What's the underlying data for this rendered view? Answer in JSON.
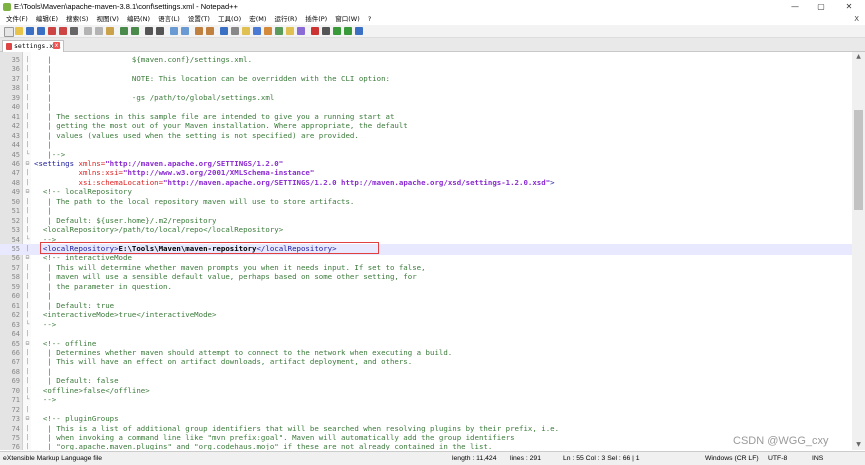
{
  "window": {
    "title": "E:\\Tools\\Maven\\apache-maven-3.8.1\\conf\\settings.xml - Notepad++",
    "minimize": "—",
    "maximize": "▢",
    "close": "✕"
  },
  "menu": [
    "文件(F)",
    "编辑(E)",
    "搜索(S)",
    "视图(V)",
    "编码(N)",
    "语言(L)",
    "设置(T)",
    "工具(O)",
    "宏(M)",
    "运行(R)",
    "插件(P)",
    "窗口(W)",
    "?"
  ],
  "menu_close": "X",
  "tab": {
    "label": "settings.xml",
    "close": "x"
  },
  "editor": {
    "lines": [
      {
        "n": "35",
        "f": "|",
        "segs": [
          {
            "c": "cm",
            "t": "   |                  ${maven.conf}/settings.xml."
          }
        ]
      },
      {
        "n": "36",
        "f": "|",
        "segs": [
          {
            "c": "cm",
            "t": "   |"
          }
        ]
      },
      {
        "n": "37",
        "f": "|",
        "segs": [
          {
            "c": "cm",
            "t": "   |                  NOTE: This location can be overridden with the CLI option:"
          }
        ]
      },
      {
        "n": "38",
        "f": "|",
        "segs": [
          {
            "c": "cm",
            "t": "   |"
          }
        ]
      },
      {
        "n": "39",
        "f": "|",
        "segs": [
          {
            "c": "cm",
            "t": "   |                  -gs /path/to/global/settings.xml"
          }
        ]
      },
      {
        "n": "40",
        "f": "|",
        "segs": [
          {
            "c": "cm",
            "t": "   |"
          }
        ]
      },
      {
        "n": "41",
        "f": "|",
        "segs": [
          {
            "c": "cm",
            "t": "   | The sections in this sample file are intended to give you a running start at"
          }
        ]
      },
      {
        "n": "42",
        "f": "|",
        "segs": [
          {
            "c": "cm",
            "t": "   | getting the most out of your Maven installation. Where appropriate, the default"
          }
        ]
      },
      {
        "n": "43",
        "f": "|",
        "segs": [
          {
            "c": "cm",
            "t": "   | values (values used when the setting is not specified) are provided."
          }
        ]
      },
      {
        "n": "44",
        "f": "|",
        "segs": [
          {
            "c": "cm",
            "t": "   |"
          }
        ]
      },
      {
        "n": "45",
        "f": "└",
        "segs": [
          {
            "c": "cm",
            "t": "   |-->"
          }
        ]
      },
      {
        "n": "46",
        "f": "⊟",
        "segs": [
          {
            "c": "tg",
            "t": "<settings "
          },
          {
            "c": "at",
            "t": "xmlns="
          },
          {
            "c": "av",
            "t": "\"http://maven.apache.org/SETTINGS/1.2.0\""
          }
        ]
      },
      {
        "n": "47",
        "f": "|",
        "segs": [
          {
            "c": "at",
            "t": "          xmlns:xsi="
          },
          {
            "c": "av",
            "t": "\"http://www.w3.org/2001/XMLSchema-instance\""
          }
        ]
      },
      {
        "n": "48",
        "f": "|",
        "segs": [
          {
            "c": "at",
            "t": "          xsi:schemaLocation="
          },
          {
            "c": "av",
            "t": "\"http://maven.apache.org/SETTINGS/1.2.0 http://maven.apache.org/xsd/settings-1.2.0.xsd\""
          },
          {
            "c": "tg",
            "t": ">"
          }
        ]
      },
      {
        "n": "49",
        "f": "⊟",
        "segs": [
          {
            "c": "cm",
            "t": "  <!-- localRepository"
          }
        ]
      },
      {
        "n": "50",
        "f": "|",
        "segs": [
          {
            "c": "cm",
            "t": "   | The path to the local repository maven will use to store artifacts."
          }
        ]
      },
      {
        "n": "51",
        "f": "|",
        "segs": [
          {
            "c": "cm",
            "t": "   |"
          }
        ]
      },
      {
        "n": "52",
        "f": "|",
        "segs": [
          {
            "c": "cm",
            "t": "   | Default: ${user.home}/.m2/repository"
          }
        ]
      },
      {
        "n": "53",
        "f": "|",
        "segs": [
          {
            "c": "cm",
            "t": "  <localRepository>/path/to/local/repo</localRepository>"
          }
        ]
      },
      {
        "n": "54",
        "f": "└",
        "segs": [
          {
            "c": "cm",
            "t": "  -->"
          }
        ]
      },
      {
        "n": "55",
        "f": "|",
        "cur": true,
        "segs": [
          {
            "c": "tg",
            "t": "  <localRepository>"
          },
          {
            "c": "tx",
            "t": "E:\\Tools\\Maven\\maven-repository"
          },
          {
            "c": "tg",
            "t": "</localRepository>"
          }
        ]
      },
      {
        "n": "56",
        "f": "⊟",
        "segs": [
          {
            "c": "cm",
            "t": "  <!-- interactiveMode"
          }
        ]
      },
      {
        "n": "57",
        "f": "|",
        "segs": [
          {
            "c": "cm",
            "t": "   | This will determine whether maven prompts you when it needs input. If set to false,"
          }
        ]
      },
      {
        "n": "58",
        "f": "|",
        "segs": [
          {
            "c": "cm",
            "t": "   | maven will use a sensible default value, perhaps based on some other setting, for"
          }
        ]
      },
      {
        "n": "59",
        "f": "|",
        "segs": [
          {
            "c": "cm",
            "t": "   | the parameter in question."
          }
        ]
      },
      {
        "n": "60",
        "f": "|",
        "segs": [
          {
            "c": "cm",
            "t": "   |"
          }
        ]
      },
      {
        "n": "61",
        "f": "|",
        "segs": [
          {
            "c": "cm",
            "t": "   | Default: true"
          }
        ]
      },
      {
        "n": "62",
        "f": "|",
        "segs": [
          {
            "c": "cm",
            "t": "  <interactiveMode>true</interactiveMode>"
          }
        ]
      },
      {
        "n": "63",
        "f": "└",
        "segs": [
          {
            "c": "cm",
            "t": "  -->"
          }
        ]
      },
      {
        "n": "64",
        "f": "|",
        "segs": [
          {
            "c": "cm",
            "t": ""
          }
        ]
      },
      {
        "n": "65",
        "f": "⊟",
        "segs": [
          {
            "c": "cm",
            "t": "  <!-- offline"
          }
        ]
      },
      {
        "n": "66",
        "f": "|",
        "segs": [
          {
            "c": "cm",
            "t": "   | Determines whether maven should attempt to connect to the network when executing a build."
          }
        ]
      },
      {
        "n": "67",
        "f": "|",
        "segs": [
          {
            "c": "cm",
            "t": "   | This will have an effect on artifact downloads, artifact deployment, and others."
          }
        ]
      },
      {
        "n": "68",
        "f": "|",
        "segs": [
          {
            "c": "cm",
            "t": "   |"
          }
        ]
      },
      {
        "n": "69",
        "f": "|",
        "segs": [
          {
            "c": "cm",
            "t": "   | Default: false"
          }
        ]
      },
      {
        "n": "70",
        "f": "|",
        "segs": [
          {
            "c": "cm",
            "t": "  <offline>false</offline>"
          }
        ]
      },
      {
        "n": "71",
        "f": "└",
        "segs": [
          {
            "c": "cm",
            "t": "  -->"
          }
        ]
      },
      {
        "n": "72",
        "f": "|",
        "segs": [
          {
            "c": "cm",
            "t": ""
          }
        ]
      },
      {
        "n": "73",
        "f": "⊟",
        "segs": [
          {
            "c": "cm",
            "t": "  <!-- pluginGroups"
          }
        ]
      },
      {
        "n": "74",
        "f": "|",
        "segs": [
          {
            "c": "cm",
            "t": "   | This is a list of additional group identifiers that will be searched when resolving plugins by their prefix, i.e."
          }
        ]
      },
      {
        "n": "75",
        "f": "|",
        "segs": [
          {
            "c": "cm",
            "t": "   | when invoking a command line like \"mvn prefix:goal\". Maven will automatically add the group identifiers"
          }
        ]
      },
      {
        "n": "76",
        "f": "|",
        "segs": [
          {
            "c": "cm",
            "t": "   | \"org.apache.maven.plugins\" and \"org.codehaus.mojo\" if these are not already contained in the list."
          }
        ]
      }
    ]
  },
  "status": {
    "lang": "eXtensible Markup Language file",
    "length": "length : 11,424",
    "lines": "lines : 291",
    "pos": "Ln : 55    Col : 3    Sel : 66 | 1",
    "eol": "Windows (CR LF)",
    "enc": "UTF-8",
    "ins": "INS"
  },
  "watermark": "CSDN @WGG_cxy"
}
